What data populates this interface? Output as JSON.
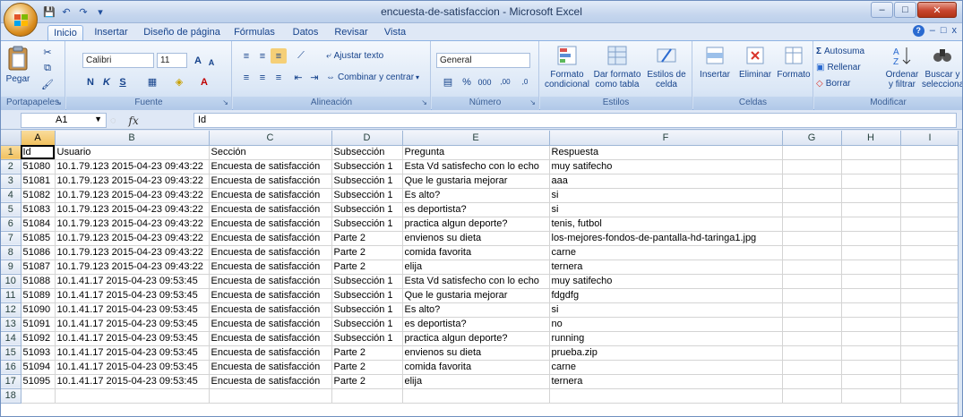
{
  "window": {
    "title": "encuesta-de-satisfaccion - Microsoft Excel",
    "controls": {
      "minimize": "‒",
      "maximize": "□",
      "close": "✕"
    }
  },
  "qat": {
    "save": "💾",
    "undo": "↶",
    "redo": "↷",
    "more": "▾"
  },
  "tabs": [
    {
      "label": "Inicio",
      "active": true
    },
    {
      "label": "Insertar"
    },
    {
      "label": "Diseño de página"
    },
    {
      "label": "Fórmulas"
    },
    {
      "label": "Datos"
    },
    {
      "label": "Revisar"
    },
    {
      "label": "Vista"
    }
  ],
  "help": {
    "help_icon": "?",
    "min": "‒",
    "restore": "□",
    "close": "x"
  },
  "ribbon": {
    "clipboard": {
      "label": "Portapapeles",
      "paste": "Pegar"
    },
    "font": {
      "label": "Fuente",
      "family": "Calibri",
      "size": "11",
      "bold": "N",
      "italic": "K",
      "underline": "S",
      "grow": "A",
      "shrink": "A"
    },
    "alignment": {
      "label": "Alineación",
      "wrap": "Ajustar texto",
      "merge": "Combinar y centrar"
    },
    "number": {
      "label": "Número",
      "format": "General",
      "percent": "%",
      "thousands": "000",
      "inc_decimals": ",00",
      "dec_decimals": ",0"
    },
    "styles": {
      "label": "Estilos",
      "conditional_1": "Formato",
      "conditional_2": "condicional",
      "table_1": "Dar formato",
      "table_2": "como tabla",
      "cell_1": "Estilos de",
      "cell_2": "celda"
    },
    "cells": {
      "label": "Celdas",
      "insert": "Insertar",
      "delete": "Eliminar",
      "format": "Formato"
    },
    "editing": {
      "label": "Modificar",
      "autosum": "Autosuma",
      "fill": "Rellenar",
      "clear": "Borrar",
      "sort_1": "Ordenar",
      "sort_2": "y filtrar",
      "find_1": "Buscar y",
      "find_2": "seleccionar"
    }
  },
  "formula_bar": {
    "name_box": "A1",
    "fx": "fx",
    "value": "Id"
  },
  "sheet": {
    "columns": [
      "A",
      "B",
      "C",
      "D",
      "E",
      "F",
      "G",
      "H",
      "I"
    ],
    "rows": [
      [
        "Id",
        "Usuario",
        "Sección",
        "Subsección",
        "Pregunta",
        "Respuesta",
        "",
        "",
        ""
      ],
      [
        "51080",
        "10.1.79.123 2015-04-23 09:43:22",
        "Encuesta de satisfacción",
        "Subsección 1",
        "Esta Vd satisfecho con lo echo",
        "muy satifecho",
        "",
        "",
        ""
      ],
      [
        "51081",
        "10.1.79.123 2015-04-23 09:43:22",
        "Encuesta de satisfacción",
        "Subsección 1",
        "Que le gustaria mejorar",
        "aaa",
        "",
        "",
        ""
      ],
      [
        "51082",
        "10.1.79.123 2015-04-23 09:43:22",
        "Encuesta de satisfacción",
        "Subsección 1",
        "Es alto?",
        "si",
        "",
        "",
        ""
      ],
      [
        "51083",
        "10.1.79.123 2015-04-23 09:43:22",
        "Encuesta de satisfacción",
        "Subsección 1",
        "es deportista?",
        "si",
        "",
        "",
        ""
      ],
      [
        "51084",
        "10.1.79.123 2015-04-23 09:43:22",
        "Encuesta de satisfacción",
        "Subsección 1",
        "practica algun deporte?",
        "tenis, futbol",
        "",
        "",
        ""
      ],
      [
        "51085",
        "10.1.79.123 2015-04-23 09:43:22",
        "Encuesta de satisfacción",
        "Parte 2",
        "envienos su dieta",
        "los-mejores-fondos-de-pantalla-hd-taringa1.jpg",
        "",
        "",
        ""
      ],
      [
        "51086",
        "10.1.79.123 2015-04-23 09:43:22",
        "Encuesta de satisfacción",
        "Parte 2",
        "comida favorita",
        "carne",
        "",
        "",
        ""
      ],
      [
        "51087",
        "10.1.79.123 2015-04-23 09:43:22",
        "Encuesta de satisfacción",
        "Parte 2",
        "elija",
        "ternera",
        "",
        "",
        ""
      ],
      [
        "51088",
        "10.1.41.17 2015-04-23 09:53:45",
        "Encuesta de satisfacción",
        "Subsección 1",
        "Esta Vd satisfecho con lo echo",
        "muy satifecho",
        "",
        "",
        ""
      ],
      [
        "51089",
        "10.1.41.17 2015-04-23 09:53:45",
        "Encuesta de satisfacción",
        "Subsección 1",
        "Que le gustaria mejorar",
        "fdgdfg",
        "",
        "",
        ""
      ],
      [
        "51090",
        "10.1.41.17 2015-04-23 09:53:45",
        "Encuesta de satisfacción",
        "Subsección 1",
        "Es alto?",
        "si",
        "",
        "",
        ""
      ],
      [
        "51091",
        "10.1.41.17 2015-04-23 09:53:45",
        "Encuesta de satisfacción",
        "Subsección 1",
        "es deportista?",
        "no",
        "",
        "",
        ""
      ],
      [
        "51092",
        "10.1.41.17 2015-04-23 09:53:45",
        "Encuesta de satisfacción",
        "Subsección 1",
        "practica algun deporte?",
        "running",
        "",
        "",
        ""
      ],
      [
        "51093",
        "10.1.41.17 2015-04-23 09:53:45",
        "Encuesta de satisfacción",
        "Parte 2",
        "envienos su dieta",
        "prueba.zip",
        "",
        "",
        ""
      ],
      [
        "51094",
        "10.1.41.17 2015-04-23 09:53:45",
        "Encuesta de satisfacción",
        "Parte 2",
        "comida favorita",
        "carne",
        "",
        "",
        ""
      ],
      [
        "51095",
        "10.1.41.17 2015-04-23 09:53:45",
        "Encuesta de satisfacción",
        "Parte 2",
        "elija",
        "ternera",
        "",
        "",
        ""
      ],
      [
        "",
        "",
        "",
        "",
        "",
        "",
        "",
        "",
        ""
      ]
    ]
  }
}
